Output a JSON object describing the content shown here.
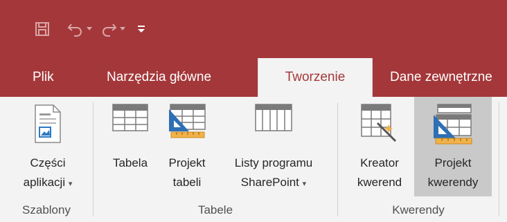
{
  "quick_access": {
    "items": [
      "save-icon",
      "undo-icon",
      "redo-icon",
      "customize-icon"
    ]
  },
  "tabs": [
    {
      "label": "Plik"
    },
    {
      "label": "Narzędzia główne"
    },
    {
      "label": "Tworzenie",
      "active": true
    },
    {
      "label": "Dane zewnętrzne"
    }
  ],
  "groups": {
    "szablony": {
      "label": "Szablony",
      "buttons": [
        {
          "line1": "Części",
          "line2": "aplikacji",
          "has_dropdown": true
        }
      ]
    },
    "tabele": {
      "label": "Tabele",
      "buttons": [
        {
          "line1": "Tabela",
          "line2": ""
        },
        {
          "line1": "Projekt",
          "line2": "tabeli"
        },
        {
          "line1": "Listy programu",
          "line2": "SharePoint",
          "has_dropdown": true
        }
      ]
    },
    "kwerendy": {
      "label": "Kwerendy",
      "buttons": [
        {
          "line1": "Kreator",
          "line2": "kwerend"
        },
        {
          "line1": "Projekt",
          "line2": "kwerendy",
          "pressed": true
        }
      ]
    }
  },
  "colors": {
    "accent": "#a4373a",
    "ribbon_bg": "#f3f3f3",
    "pressed_bg": "#c9c9c9"
  },
  "dropdown_glyph": "▾"
}
